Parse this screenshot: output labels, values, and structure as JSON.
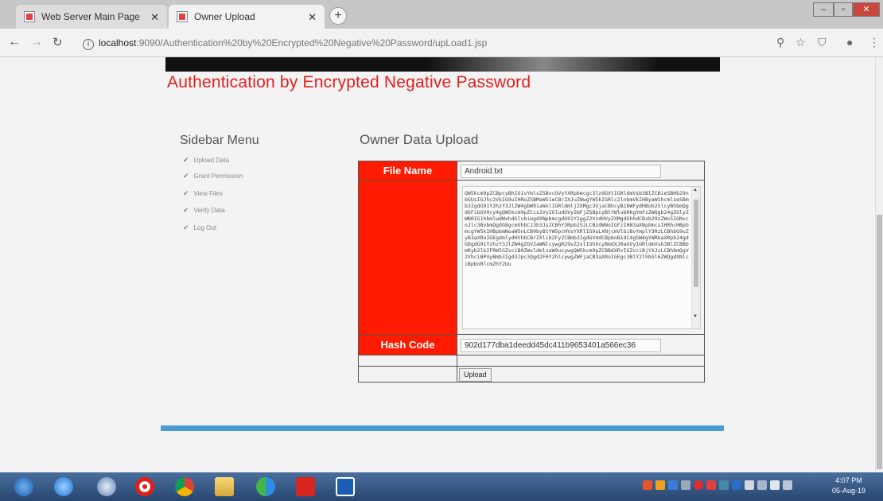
{
  "browser": {
    "tabs": [
      {
        "title": "Web Server Main Page",
        "active": false
      },
      {
        "title": "Owner Upload",
        "active": true
      }
    ],
    "url_host": "localhost",
    "url_path": ":9090/Authentication%20by%20Encrypted%20Negative%20Password/upLoad1.jsp"
  },
  "page": {
    "site_title": "Authentication by Encrypted Negative Password",
    "sidebar": {
      "heading": "Sidebar Menu",
      "items": [
        "Upload Data",
        "Grant Permission",
        "View Files",
        "Verify Data",
        "Log Out"
      ]
    },
    "content_heading": "Owner Data Upload",
    "form": {
      "file_name_label": "File Name",
      "file_name_value": "Android.txt",
      "content_value": "QW5kcm9pZCBpcyBhIG1vYmlsZSBvcGVyYXRpbmcgc3lzdGVtIGRldmVsb3BlZCBieSBHb29nbGUsIGJhc2VkIG9uIHRoZSBMaW51eCBrZXJuZWwgYW5kIGRlc2lnbmVkIHByaW1hcmlseSBmb3IgdG91Y2hzY3JlZW4gbW9iaWxlIGRldmljZXMgc3VjaCBhcyBzbWFydHBob25lcyBhbmQgdGFibGV0cy4gQW5kcm9pZCcs2VyIGludGVyZmFjZSBpcyBtYWlubHkgYmFzZWQgb24gZGlyZWN0IG1hbmlwdWxhdGlvbiwgdXNpbmcgdG91Y2ggZ2VzdHVyZXMgdGhhdCBsb29zZWx5IGNvcnJlc3BvbmQgdG8gcmVhbC13b3JsZCBhY3Rpb25zLCBzdWNoIGFzIHN3aXBpbmcsIHRhcHBpbmcgYW5kIHBpbmNoaW5nLCB0byBtYW5pcHVsYXRlIG9uLXNjcmVlbiBvYmplY3RzLCBhbG9uZyB3aXRoIGEgdmlydHVhbCBrZXlib2FyZCBmb3IgdGV4dCBpbnB1dC4gSW4gYWRkaXRpb24gdG8gdG91Y2hzY3JlZW4gZGV2aWNlcywgR29vZ2xlIGhhcyBmdXJ0aGVyIGRldmVsb3BlZCBBbmRyb2lkIFRWIGZvciB0ZWxldmlzaW9ucywgQW5kcm9pZCBBdXRvIGZvciBjYXJzLCBhbmQgV2VhciBPUyBmb3Igd3Jpc3Qgd2F0Y2hlcywgZWFjaCB3aXRoIGEgc3BlY2lhbGl6ZWQgdXNlciBpbnRlcmZhY2Uu",
      "hash_code_label": "Hash Code",
      "hash_code_value": "902d177dba1deedd45dc411b9653401a566ec36",
      "upload_label": "Upload"
    }
  },
  "taskbar": {
    "time": "4:07 PM",
    "date": "05-Aug-19"
  },
  "colors": {
    "title_red": "#e02020",
    "label_red": "#ff1a00",
    "footer_blue": "#4a9bd8"
  }
}
